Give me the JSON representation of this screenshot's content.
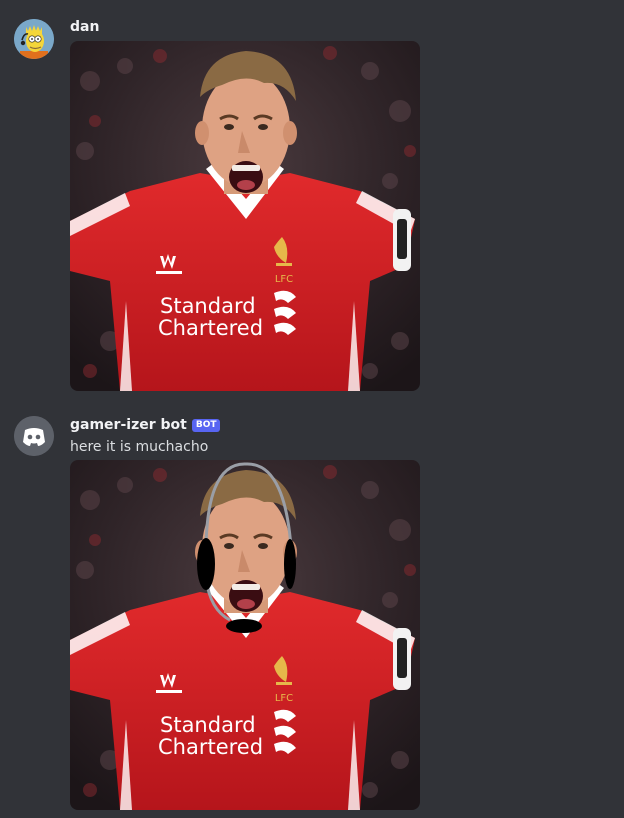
{
  "messages": [
    {
      "author": "dan",
      "avatar_icon": "cartoon-character-avatar",
      "attachment": {
        "alt": "image attachment",
        "shirt_text_line1": "Standard",
        "shirt_text_line2": "Chartered",
        "crest_text": "LFC"
      }
    },
    {
      "author": "gamer-izer bot",
      "badge": "BOT",
      "avatar_icon": "discord-logo-avatar",
      "text": "here it is muchacho",
      "attachment": {
        "alt": "edited image attachment",
        "shirt_text_line1": "Standard",
        "shirt_text_line2": "Chartered",
        "crest_text": "LFC",
        "overlay_icon": "headset-overlay"
      }
    }
  ],
  "colors": {
    "background": "#313338",
    "username": "#f2f3f5",
    "text": "#dbdee1",
    "bot_badge": "#5865f2",
    "shirt_red": "#d51e24",
    "crowd_dark": "#2a1e22"
  }
}
